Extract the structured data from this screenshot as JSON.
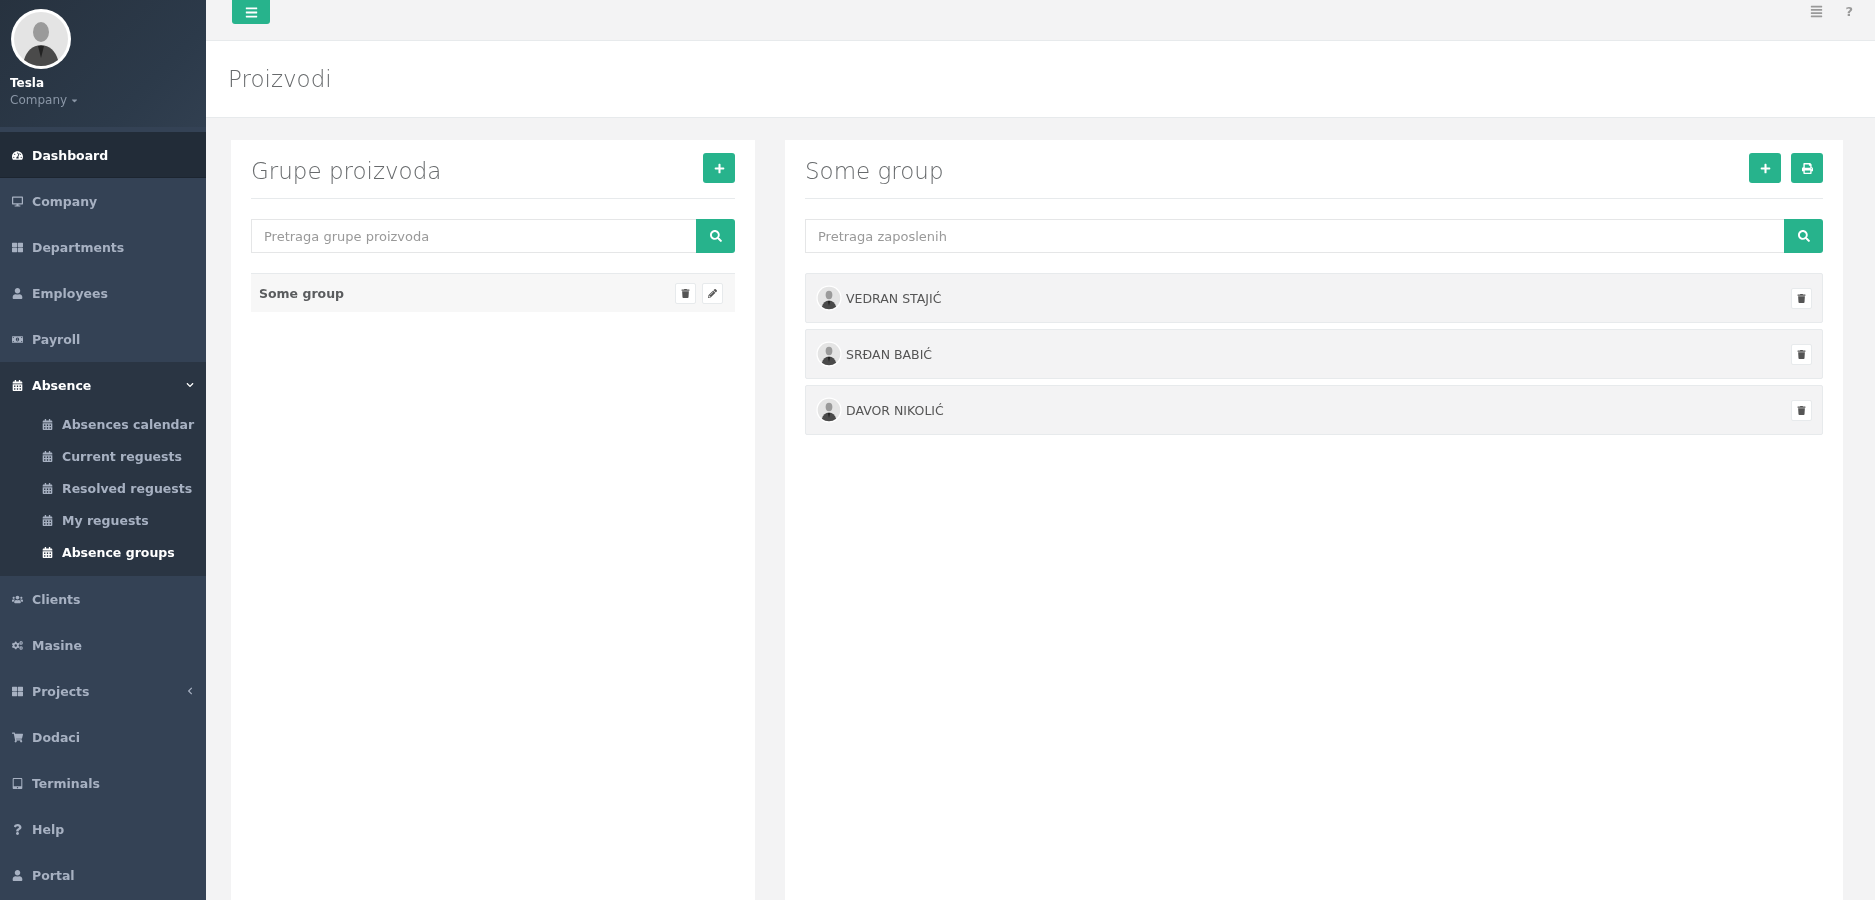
{
  "user": {
    "name": "Tesla",
    "role": "Company"
  },
  "sidebar": {
    "items": [
      {
        "label": "Dashboard",
        "kind": "link",
        "selected": true,
        "expanded": false
      },
      {
        "label": "Company",
        "kind": "link",
        "selected": false,
        "expanded": false
      },
      {
        "label": "Departments",
        "kind": "link",
        "selected": false,
        "expanded": false
      },
      {
        "label": "Employees",
        "kind": "link",
        "selected": false,
        "expanded": false
      },
      {
        "label": "Payroll",
        "kind": "link",
        "selected": false,
        "expanded": false
      },
      {
        "label": "Absence",
        "kind": "group",
        "selected": false,
        "expanded": true,
        "children": [
          {
            "label": "Absences calendar",
            "selected": false
          },
          {
            "label": "Current reguests",
            "selected": false
          },
          {
            "label": "Resolved reguests",
            "selected": false
          },
          {
            "label": "My reguests",
            "selected": false
          },
          {
            "label": "Absence groups",
            "selected": true
          }
        ]
      },
      {
        "label": "Clients",
        "kind": "link",
        "selected": false,
        "expanded": false
      },
      {
        "label": "Masine",
        "kind": "link",
        "selected": false,
        "expanded": false
      },
      {
        "label": "Projects",
        "kind": "group",
        "selected": false,
        "expanded": false
      },
      {
        "label": "Dodaci",
        "kind": "link",
        "selected": false,
        "expanded": false
      },
      {
        "label": "Terminals",
        "kind": "link",
        "selected": false,
        "expanded": false
      },
      {
        "label": "Help",
        "kind": "link",
        "selected": false,
        "expanded": false
      },
      {
        "label": "Portal",
        "kind": "link",
        "selected": false,
        "expanded": false
      }
    ]
  },
  "topbar": {
    "help": "?"
  },
  "page_title": "Proizvodi",
  "groups_panel": {
    "title": "Grupe proizvoda",
    "search": {
      "placeholder": "Pretraga grupe proizvoda"
    },
    "groups": [
      {
        "name": "Some group"
      }
    ]
  },
  "members_panel": {
    "title": "Some group",
    "search": {
      "placeholder": "Pretraga zaposlenih"
    },
    "members": [
      {
        "name": "VEDRAN STAJIĆ"
      },
      {
        "name": "SRĐAN BABIĆ"
      },
      {
        "name": "DAVOR NIKOLIĆ"
      }
    ]
  }
}
